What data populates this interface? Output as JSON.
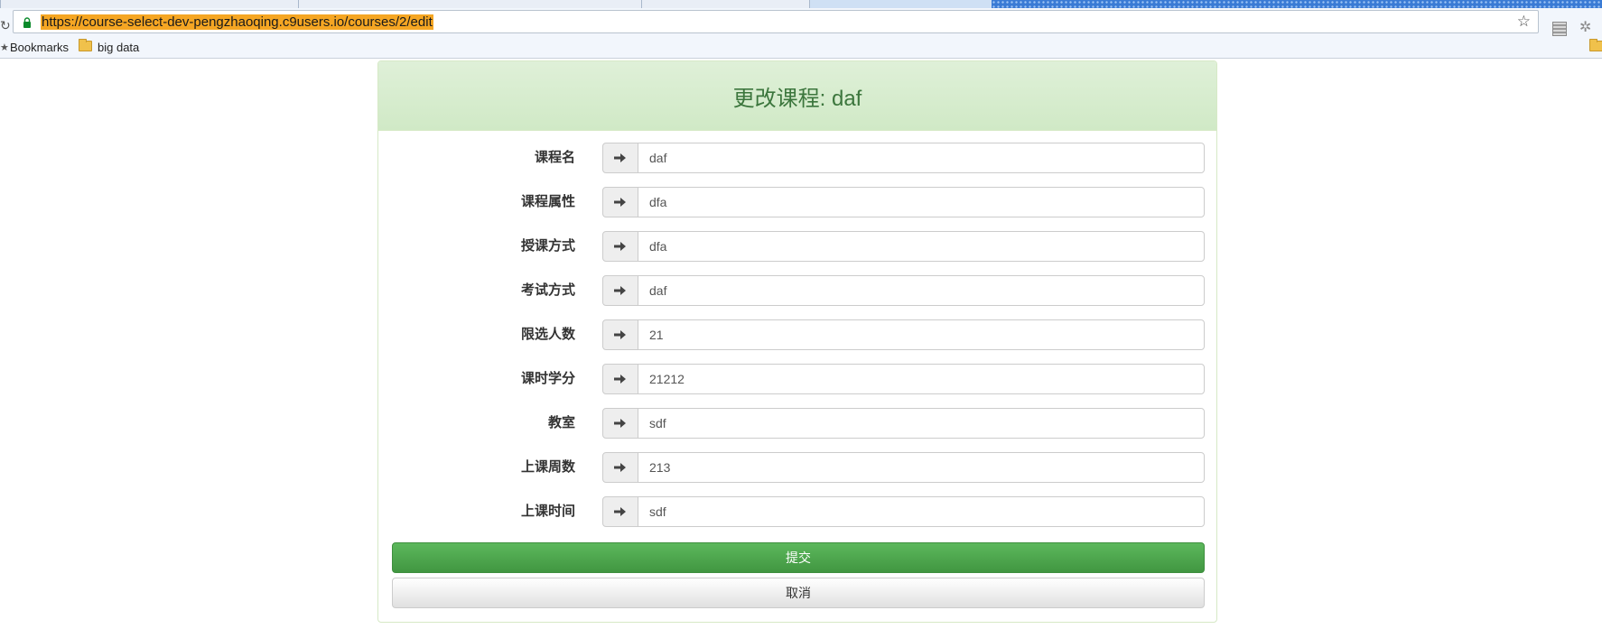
{
  "browser": {
    "url": "https://course-select-dev-pengzhaoqing.c9users.io/courses/2/edit",
    "bookmarks": [
      {
        "label": "Bookmarks"
      },
      {
        "label": "big data"
      }
    ],
    "icons": [
      "reload-icon",
      "lock-icon",
      "star-icon",
      "folder-icon"
    ]
  },
  "page": {
    "title": "更改课程: daf",
    "fields": [
      {
        "label": "课程名",
        "value": "daf"
      },
      {
        "label": "课程属性",
        "value": "dfa"
      },
      {
        "label": "授课方式",
        "value": "dfa"
      },
      {
        "label": "考试方式",
        "value": "daf"
      },
      {
        "label": "限选人数",
        "value": "21"
      },
      {
        "label": "课时学分",
        "value": "21212"
      },
      {
        "label": "教室",
        "value": "sdf"
      },
      {
        "label": "上课周数",
        "value": "213"
      },
      {
        "label": "上课时间",
        "value": "sdf"
      }
    ],
    "submit_label": "提交",
    "cancel_label": "取消"
  },
  "colors": {
    "panel_heading_bg": "#dff0d8",
    "panel_title": "#3c763d",
    "submit_bg": "#5cb85c",
    "url_highlight": "#f5a623"
  }
}
